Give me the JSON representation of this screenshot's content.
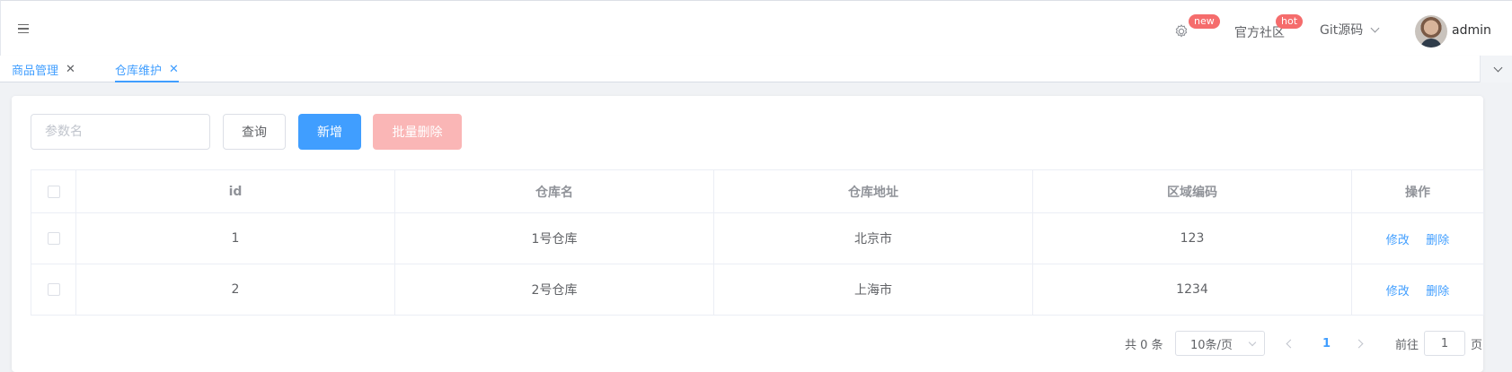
{
  "header": {
    "badge_new": "new",
    "community_label": "官方社区",
    "badge_hot": "hot",
    "git_label": "Git源码",
    "user_name": "admin"
  },
  "tabs": [
    {
      "label": "商品管理",
      "active": false
    },
    {
      "label": "仓库维护",
      "active": true
    }
  ],
  "toolbar": {
    "search_placeholder": "参数名",
    "query_label": "查询",
    "add_label": "新增",
    "batch_delete_label": "批量删除"
  },
  "table": {
    "headers": [
      "id",
      "仓库名",
      "仓库地址",
      "区域编码",
      "操作"
    ],
    "rows": [
      {
        "id": "1",
        "name": "1号仓库",
        "address": "北京市",
        "code": "123"
      },
      {
        "id": "2",
        "name": "2号仓库",
        "address": "上海市",
        "code": "1234"
      }
    ],
    "edit_label": "修改",
    "delete_label": "删除"
  },
  "pagination": {
    "total_text": "共 0 条",
    "page_size": "10条/页",
    "current_page": "1",
    "goto_prefix": "前往",
    "goto_value": "1",
    "goto_suffix": "页"
  },
  "colors": {
    "primary": "#409eff",
    "danger_light": "#fab6b6",
    "badge": "#f56c6c"
  },
  "icons": [
    "hamburger-icon",
    "gear-icon",
    "chevron-down-icon",
    "close-icon",
    "chevron-left-icon",
    "chevron-right-icon"
  ]
}
